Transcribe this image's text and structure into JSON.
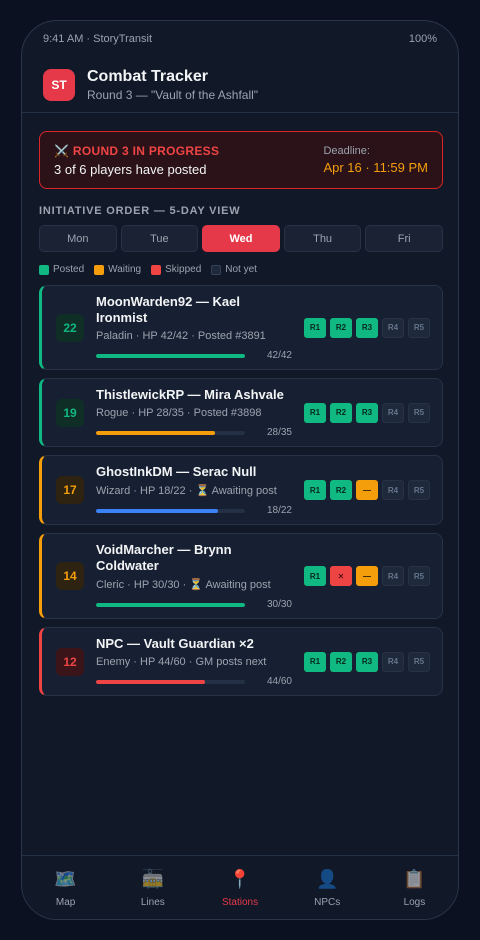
{
  "status_bar": {
    "left": "9:41 AM · StoryTransit",
    "right": "100%"
  },
  "header": {
    "logo": "ST",
    "title": "Combat Tracker",
    "subtitle": "Round 3 — \"Vault of the Ashfall\""
  },
  "banner": {
    "icon": "crossed-swords-icon",
    "title": "⚔️ ROUND 3 IN PROGRESS",
    "subtitle": "3 of 6 players have posted",
    "deadline_label": "Deadline:",
    "deadline_value": "Apr 16 · 11:59 PM"
  },
  "initiative": {
    "label": "INITIATIVE ORDER — 5-DAY VIEW",
    "days": [
      "Mon",
      "Tue",
      "Wed",
      "Thu",
      "Fri"
    ],
    "active_day": "Wed"
  },
  "legend": [
    {
      "label": "Posted",
      "color": "#10b981"
    },
    {
      "label": "Waiting",
      "color": "#f59e0b"
    },
    {
      "label": "Skipped",
      "color": "#ef4444"
    },
    {
      "label": "Not yet",
      "color": "#1e293b"
    }
  ],
  "combatants": [
    {
      "initiative": "22",
      "name": "MoonWarden92 — Kael Ironmist",
      "meta": "Paladin · HP 42/42 · Posted #3891",
      "hp_text": "42/42",
      "hp_fraction": 1.0,
      "accent": "#10b981",
      "hp_color": "#10b981",
      "badge_bg": "#0f2e25",
      "badge_fg": "#10b981",
      "rounds": [
        {
          "label": "R1",
          "state": "posted"
        },
        {
          "label": "R2",
          "state": "posted"
        },
        {
          "label": "R3",
          "state": "posted"
        },
        {
          "label": "R4",
          "state": "notyet"
        },
        {
          "label": "R5",
          "state": "notyet"
        }
      ]
    },
    {
      "initiative": "19",
      "name": "ThistlewickRP — Mira Ashvale",
      "meta": "Rogue · HP 28/35 · Posted #3898",
      "hp_text": "28/35",
      "hp_fraction": 0.8,
      "accent": "#10b981",
      "hp_color": "#f59e0b",
      "badge_bg": "#0f2e25",
      "badge_fg": "#10b981",
      "rounds": [
        {
          "label": "R1",
          "state": "posted"
        },
        {
          "label": "R2",
          "state": "posted"
        },
        {
          "label": "R3",
          "state": "posted"
        },
        {
          "label": "R4",
          "state": "notyet"
        },
        {
          "label": "R5",
          "state": "notyet"
        }
      ]
    },
    {
      "initiative": "17",
      "name": "GhostInkDM — Serac Null",
      "meta": "Wizard · HP 18/22 · ⏳ Awaiting post",
      "hp_text": "18/22",
      "hp_fraction": 0.82,
      "accent": "#f59e0b",
      "hp_color": "#3b82f6",
      "badge_bg": "#2d2310",
      "badge_fg": "#f59e0b",
      "rounds": [
        {
          "label": "R1",
          "state": "posted"
        },
        {
          "label": "R2",
          "state": "posted"
        },
        {
          "label": "—",
          "state": "waiting"
        },
        {
          "label": "R4",
          "state": "notyet"
        },
        {
          "label": "R5",
          "state": "notyet"
        }
      ]
    },
    {
      "initiative": "14",
      "name": "VoidMarcher — Brynn Coldwater",
      "meta": "Cleric · HP 30/30 · ⏳ Awaiting post",
      "hp_text": "30/30",
      "hp_fraction": 1.0,
      "accent": "#f59e0b",
      "hp_color": "#10b981",
      "badge_bg": "#2d2310",
      "badge_fg": "#f59e0b",
      "rounds": [
        {
          "label": "R1",
          "state": "posted"
        },
        {
          "label": "✕",
          "state": "skipped"
        },
        {
          "label": "—",
          "state": "waiting"
        },
        {
          "label": "R4",
          "state": "notyet"
        },
        {
          "label": "R5",
          "state": "notyet"
        }
      ]
    },
    {
      "initiative": "12",
      "name": "NPC — Vault Guardian ×2",
      "meta": "Enemy · HP 44/60 · GM posts next",
      "hp_text": "44/60",
      "hp_fraction": 0.73,
      "accent": "#ef4444",
      "hp_color": "#ef4444",
      "badge_bg": "#3a1418",
      "badge_fg": "#ef4444",
      "rounds": [
        {
          "label": "R1",
          "state": "posted"
        },
        {
          "label": "R2",
          "state": "posted"
        },
        {
          "label": "R3",
          "state": "posted"
        },
        {
          "label": "R4",
          "state": "notyet"
        },
        {
          "label": "R5",
          "state": "notyet"
        }
      ]
    }
  ],
  "nav": [
    {
      "label": "Map",
      "icon": "map-icon",
      "glyph": "🗺️"
    },
    {
      "label": "Lines",
      "icon": "tram-icon",
      "glyph": "🚋"
    },
    {
      "label": "Stations",
      "icon": "pin-icon",
      "glyph": "📍",
      "active": true
    },
    {
      "label": "NPCs",
      "icon": "person-icon",
      "glyph": "👤"
    },
    {
      "label": "Logs",
      "icon": "clipboard-icon",
      "glyph": "📋"
    }
  ]
}
